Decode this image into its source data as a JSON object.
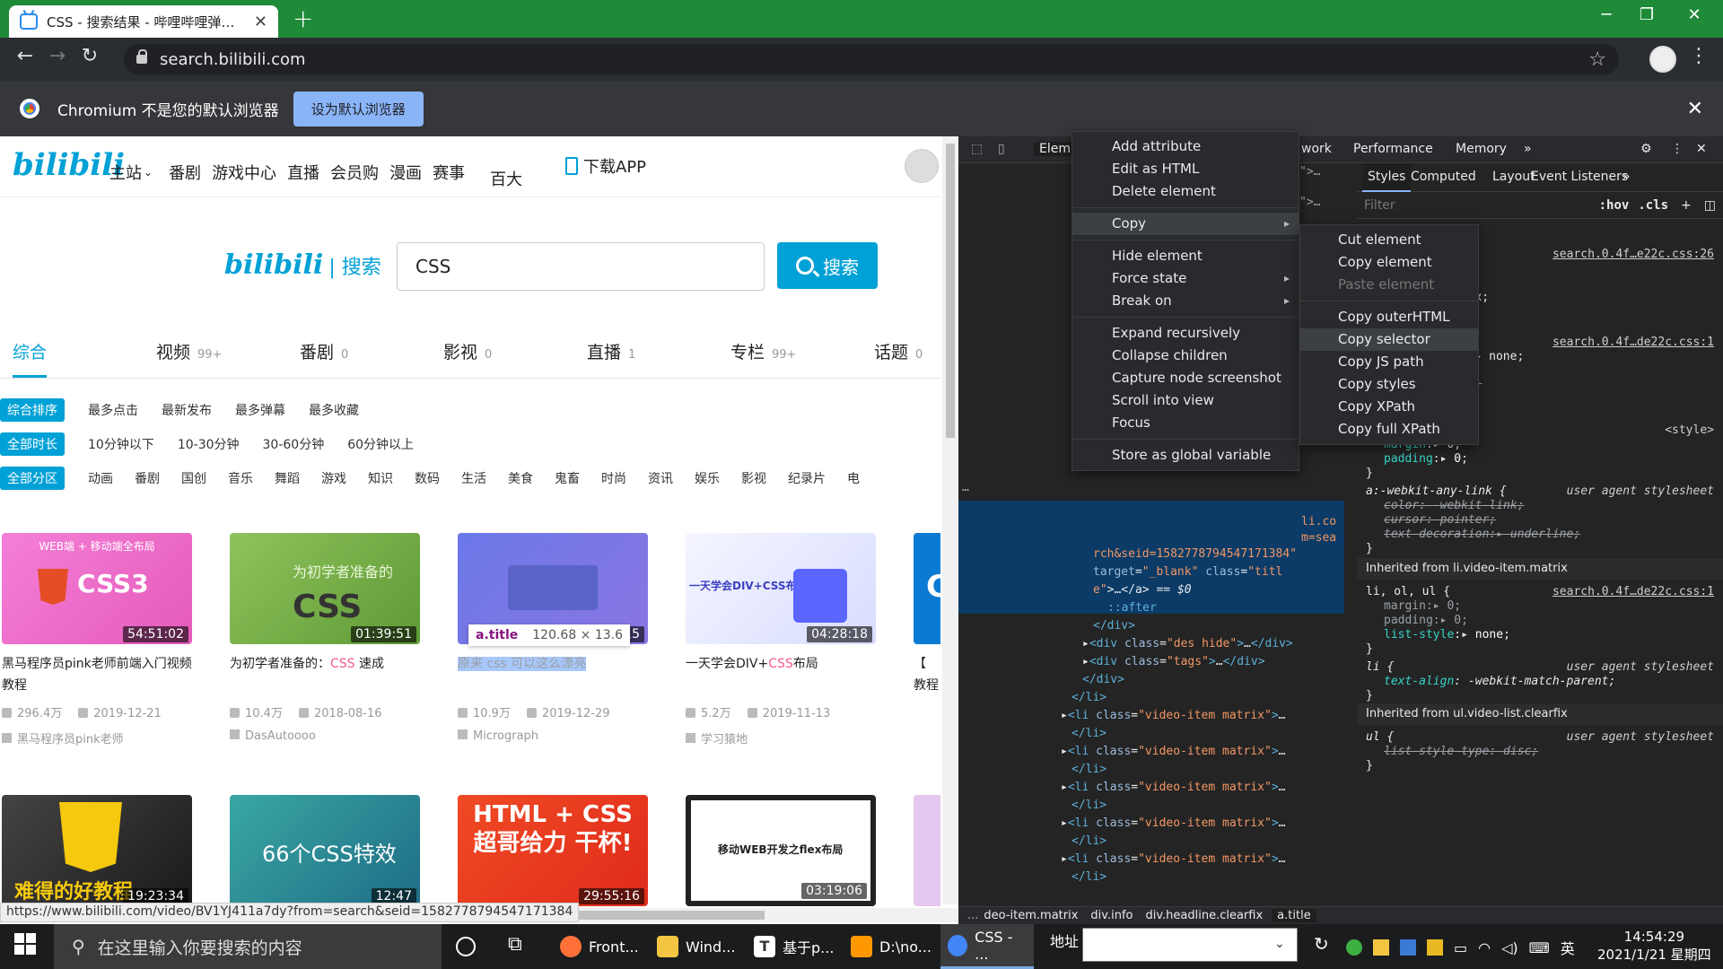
{
  "browser": {
    "tab_title": "CSS - 搜索结果 - 哔哩哔哩弹幕视",
    "url": "search.bilibili.com",
    "new_tab": "+",
    "infobar_text": "Chromium 不是您的默认浏览器",
    "infobar_button": "设为默认浏览器",
    "status_url": "https://www.bilibili.com/video/BV1YJ411a7dy?from=search&seid=1582778794547171384"
  },
  "site": {
    "logo": "bilibili",
    "nav": [
      "主站",
      "番剧",
      "游戏中心",
      "直播",
      "会员购",
      "漫画",
      "赛事",
      "百大"
    ],
    "download": "下载APP",
    "search_logo_suffix": "| 搜索",
    "search_value": "CSS",
    "search_button": "搜索",
    "tabs": [
      {
        "label": "综合",
        "count": ""
      },
      {
        "label": "视频",
        "count": "99+"
      },
      {
        "label": "番剧",
        "count": "0"
      },
      {
        "label": "影视",
        "count": "0"
      },
      {
        "label": "直播",
        "count": "1"
      },
      {
        "label": "专栏",
        "count": "99+"
      },
      {
        "label": "话题",
        "count": "0"
      }
    ],
    "filters": {
      "sort_label": "综合排序",
      "sort": [
        "最多点击",
        "最新发布",
        "最多弹幕",
        "最多收藏"
      ],
      "duration_label": "全部时长",
      "duration": [
        "10分钟以下",
        "10-30分钟",
        "30-60分钟",
        "60分钟以上"
      ],
      "zone_label": "全部分区",
      "zone": [
        "动画",
        "番剧",
        "国创",
        "音乐",
        "舞蹈",
        "游戏",
        "知识",
        "数码",
        "生活",
        "美食",
        "鬼畜",
        "时尚",
        "资讯",
        "娱乐",
        "影视",
        "纪录片",
        "电"
      ]
    },
    "cards": [
      {
        "thumb_text": "WEB端 + 移动端全布局",
        "thumb_big": "CSS3",
        "duration": "54:51:02",
        "title_pre": "黑马程序员pink老师前端入门视频教程",
        "title_hl": "",
        "title_post": "",
        "views": "296.4万",
        "date": "2019-12-21",
        "up": "黑马程序员pink老师"
      },
      {
        "thumb_text": "为初学者准备的",
        "thumb_big": "CSS",
        "duration": "01:39:51",
        "title_pre": "为初学者准备的：",
        "title_hl": "CSS",
        "title_post": " 速成",
        "views": "10.4万",
        "date": "2018-08-16",
        "up": "DasAutoooo"
      },
      {
        "thumb_text": "",
        "thumb_big": "",
        "duration": "15",
        "title_pre": "原来 ",
        "title_hl": "css",
        "title_post": " 可以这么漂亮",
        "views": "10.9万",
        "date": "2019-12-29",
        "up": "Micrograph"
      },
      {
        "thumb_text": "一天学会DIV+CSS布局",
        "thumb_big": "",
        "duration": "04:28:18",
        "title_pre": "一天学会DIV+",
        "title_hl": "CSS",
        "title_post": "布局",
        "views": "5.2万",
        "date": "2019-11-13",
        "up": "学习猿地"
      },
      {
        "thumb_text": "",
        "thumb_big": "C",
        "duration": "",
        "title_pre": "【",
        "title_hl": "",
        "title_post": "教程",
        "views": "",
        "date": "",
        "up": ""
      }
    ],
    "cards_row2": [
      {
        "thumb_text": "难得的好教程",
        "duration": "19:23:34"
      },
      {
        "thumb_text": "66个CSS特效",
        "duration": "12:47"
      },
      {
        "thumb_text": "HTML + CSS 超哥给力 干杯!",
        "duration": "29:55:16"
      },
      {
        "thumb_text": "移动WEB开发之flex布局",
        "duration": "03:19:06"
      }
    ],
    "tooltip": {
      "tag": "a.title",
      "size": "120.68 × 13.6"
    }
  },
  "devtools": {
    "tabs": [
      "Elem",
      "work",
      "Performance",
      "Memory"
    ],
    "styles_tabs": [
      "Styles",
      "Computed",
      "Layout",
      "Event Listeners"
    ],
    "filter_placeholder": "Filter",
    "hov": ":hov",
    "cls": ".cls",
    "breadcrumb": [
      "...",
      "deo-item.matrix",
      "div.info",
      "div.headline.clearfix",
      "a.title"
    ],
    "context_menu": [
      "Add attribute",
      "Edit as HTML",
      "Delete element",
      "Copy",
      "Hide element",
      "Force state",
      "Break on",
      "Expand recursively",
      "Collapse children",
      "Capture node screenshot",
      "Scroll into view",
      "Focus",
      "Store as global variable"
    ],
    "copy_menu": [
      "Cut element",
      "Copy element",
      "Paste element",
      "Copy outerHTML",
      "Copy selector",
      "Copy JS path",
      "Copy styles",
      "Copy XPath",
      "Copy full XPath"
    ],
    "style_links": [
      "search.0.4f…e22c.css:26",
      "search.0.4f…de22c.css:1",
      "search.0.4f…de22c.css:1"
    ],
    "inherited": [
      "Inherited from li.video-item.matrix",
      "Inherited from ul.video-list.clearfix"
    ],
    "ua_label": "user agent stylesheet",
    "style_tag": "<style>"
  },
  "taskbar": {
    "search_placeholder": "在这里输入你要搜索的内容",
    "apps": [
      "Front...",
      "Wind...",
      "基于p...",
      "D:\\no...",
      "CSS - ..."
    ],
    "address_label": "地址",
    "time": "14:54:29",
    "date": "2021/1/21 星期四",
    "ime": "英"
  }
}
